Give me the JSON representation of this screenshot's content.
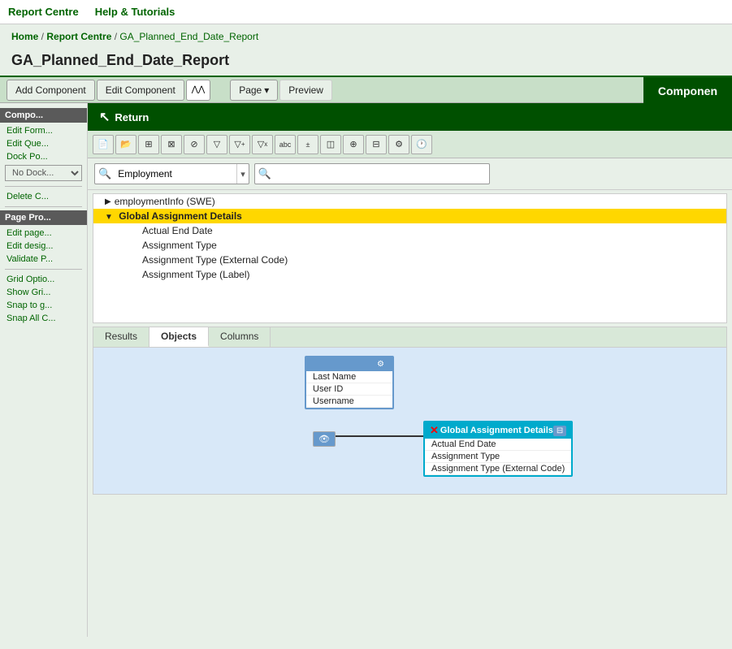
{
  "topnav": {
    "report_centre": "Report Centre",
    "help_tutorials": "Help & Tutorials"
  },
  "breadcrumb": {
    "home": "Home",
    "separator1": " / ",
    "report_centre": "Report Centre",
    "separator2": " / ",
    "page": "GA_Planned_End_Date_Report"
  },
  "page_title": "GA_Planned_End_Date_Report",
  "action_bar": {
    "add_component": "Add Component",
    "edit_component": "Edit Component",
    "page": "Page",
    "component_label": "Componen"
  },
  "left_sidebar": {
    "component_header": "Compo...",
    "edit_form": "Edit Form...",
    "edit_query": "Edit Que...",
    "dock_pos": "Dock Po...",
    "dock_dropdown": "No Dock...",
    "delete_c": "Delete C...",
    "page_properties_header": "Page Pro...",
    "edit_page": "Edit page...",
    "edit_design": "Edit desig...",
    "validate_p": "Validate P...",
    "grid_options": "Grid Optio...",
    "show_grid": "Show Gri...",
    "snap_to_g": "Snap to g...",
    "snap_all_c": "Snap All C..."
  },
  "return_bar": {
    "label": "Return"
  },
  "toolbar": {
    "buttons": [
      "☐",
      "⇱",
      "⊞",
      "⊠",
      "⊘",
      "▽",
      "▾",
      "▴",
      "abc",
      "+×",
      "⊡",
      "⊕",
      "◫",
      "⚙",
      "🕐"
    ]
  },
  "search_area": {
    "combo_value": "Employment",
    "search_placeholder": ""
  },
  "tree": {
    "items": [
      {
        "label": "employmentInfo (SWE)",
        "indent": 0,
        "arrow": "▶",
        "highlighted": false
      },
      {
        "label": "Global Assignment Details",
        "indent": 0,
        "arrow": "▼",
        "highlighted": true
      },
      {
        "label": "Actual End Date",
        "indent": 1,
        "arrow": "",
        "highlighted": false
      },
      {
        "label": "Assignment Type",
        "indent": 1,
        "arrow": "",
        "highlighted": false
      },
      {
        "label": "Assignment Type (External Code)",
        "indent": 1,
        "arrow": "",
        "highlighted": false
      },
      {
        "label": "Assignment Type (Label)",
        "indent": 1,
        "arrow": "",
        "highlighted": false
      }
    ]
  },
  "tabs": {
    "items": [
      "Results",
      "Objects",
      "Columns"
    ],
    "active": "Objects"
  },
  "objects_panel": {
    "person_box": {
      "title": "",
      "items": [
        "Last Name",
        "User ID",
        "Username"
      ]
    },
    "ga_box": {
      "title": "Global Assignment Details",
      "items": [
        "Actual End Date",
        "Assignment Type",
        "Assignment Type (External Code)"
      ]
    }
  }
}
